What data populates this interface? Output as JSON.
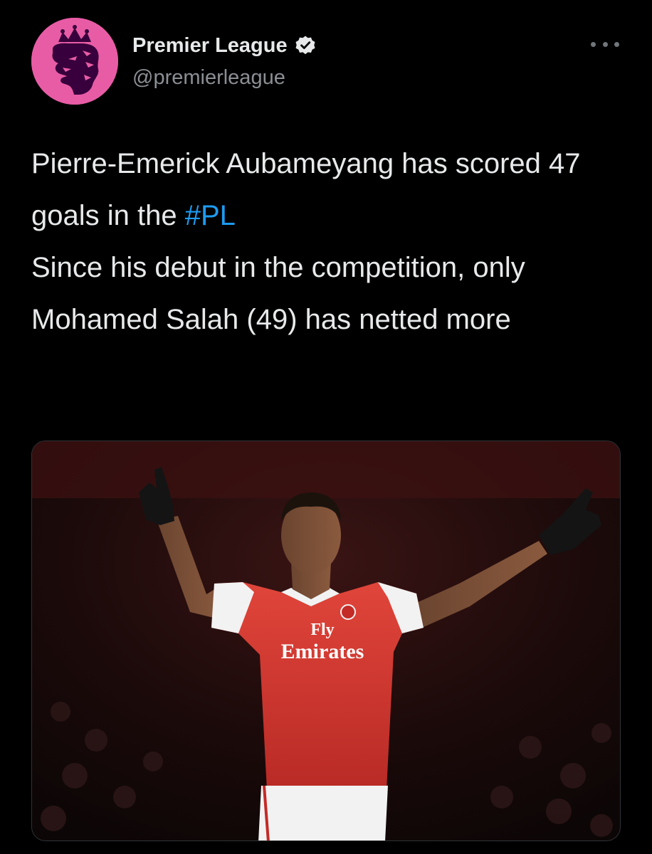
{
  "account": {
    "display_name": "Premier League",
    "handle": "@premierleague",
    "avatar_icon": "premier-league-lion-icon",
    "verified_icon": "verified-badge-icon",
    "avatar_color": "#e85ca6"
  },
  "tweet": {
    "paragraph1_text": "Pierre-Emerick Aubameyang has scored 47 goals in the ",
    "hashtag": "#PL",
    "paragraph2_text": "Since his debut in the competition, only Mohamed Salah (49) has netted more"
  },
  "media": {
    "shirt_sponsor_line1": "Fly",
    "shirt_sponsor_line2": "Emirates"
  },
  "menu_icon": "more-options-icon",
  "colors": {
    "background": "#000000",
    "text": "#e7e9ea",
    "secondary_text": "#8b8f94",
    "link": "#1d9bf0",
    "shirt_red": "#d8322f"
  }
}
